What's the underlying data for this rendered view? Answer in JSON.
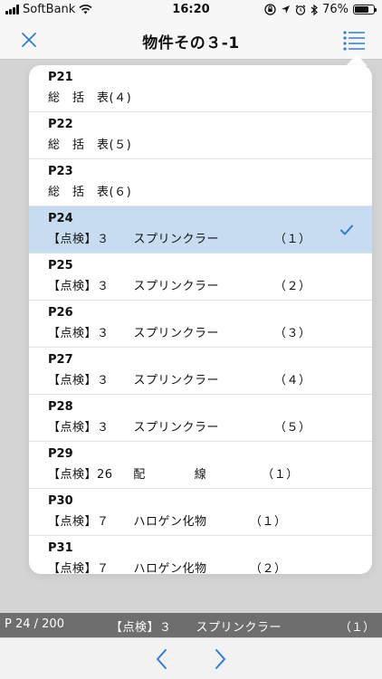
{
  "status_bar": {
    "carrier": "SoftBank",
    "time": "16:20",
    "battery": "76%",
    "battery_level": 0.76
  },
  "nav": {
    "title": "物件その３-1"
  },
  "list": {
    "selected_index": 3,
    "items": [
      {
        "page": "P21",
        "desc": "総　括　表(４)"
      },
      {
        "page": "P22",
        "desc": "総　括　表(５)"
      },
      {
        "page": "P23",
        "desc": "総　括　表(６)"
      },
      {
        "page": "P24",
        "desc": "【点検】３　　スプリンクラー　　　　　（１）"
      },
      {
        "page": "P25",
        "desc": "【点検】３　　スプリンクラー　　　　　（２）"
      },
      {
        "page": "P26",
        "desc": "【点検】３　　スプリンクラー　　　　　（３）"
      },
      {
        "page": "P27",
        "desc": "【点検】３　　スプリンクラー　　　　　（４）"
      },
      {
        "page": "P28",
        "desc": "【点検】３　　スプリンクラー　　　　　（５）"
      },
      {
        "page": "P29",
        "desc": "【点検】26　  配　　　　線　　　　　（１）"
      },
      {
        "page": "P30",
        "desc": "【点検】７　　ハロゲン化物　　　　（１）"
      },
      {
        "page": "P31",
        "desc": "【点検】７　　ハロゲン化物　　　　（２）"
      }
    ]
  },
  "info_strip": {
    "page_counter": "P 24 / 200",
    "text": "【点検】３　　スプリンクラー",
    "number": "（１）"
  },
  "colors": {
    "accent": "#2f7bd8",
    "selected_row": "#c7dcf0"
  }
}
